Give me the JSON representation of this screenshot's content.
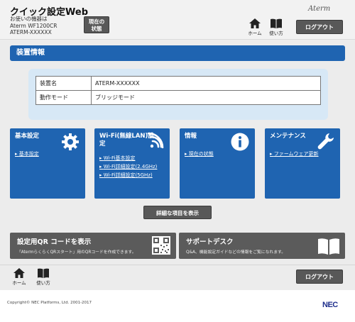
{
  "header": {
    "title": "クイック設定Web",
    "device_label": "お使いの機器は",
    "device_model": "Aterm WF1200CR",
    "device_name": "ATERM-XXXXXX",
    "status_button_line1": "現在の",
    "status_button_line2": "状態",
    "brand": "Aterm",
    "home_label": "ホーム",
    "help_label": "使い方",
    "logout_label": "ログアウト"
  },
  "section": {
    "title": "装置情報"
  },
  "info_table": [
    {
      "key": "装置名",
      "value": "ATERM-XXXXXX"
    },
    {
      "key": "動作モード",
      "value": "ブリッジモード"
    }
  ],
  "tiles": [
    {
      "title": "基本設定",
      "icon": "gear-icon",
      "links": [
        "基本設定"
      ]
    },
    {
      "title": "Wi-Fi(無線LAN)設定",
      "icon": "wifi-icon",
      "links": [
        "Wi-Fi基本設定",
        "Wi-Fi詳細設定(2.4GHz)",
        "Wi-Fi詳細設定(5GHz)"
      ]
    },
    {
      "title": "情報",
      "icon": "info-icon",
      "links": [
        "現在の状態"
      ]
    },
    {
      "title": "メンテナンス",
      "icon": "wrench-icon",
      "links": [
        "ファームウェア更新"
      ]
    }
  ],
  "detail_button": "詳細な項目を表示",
  "qr_tile": {
    "title": "設定用QR コードを表示",
    "subtitle": "「AtermらくらくQRスタート」用のQRコードを作成できます。",
    "icon": "qr-code-icon"
  },
  "support_tile": {
    "title": "サポートデスク",
    "subtitle": "Q&A、機能設定ガイドなどの情報をご覧になれます。",
    "icon": "book-icon"
  },
  "footer": {
    "home_label": "ホーム",
    "help_label": "使い方",
    "logout_label": "ログアウト",
    "copyright": "Copyright© NEC Platforms, Ltd. 2001-2017",
    "logo": "NEC"
  },
  "colors": {
    "primary_blue": "#1f64b1",
    "button_gray": "#585858",
    "panel_blue": "#d7e8f6"
  }
}
